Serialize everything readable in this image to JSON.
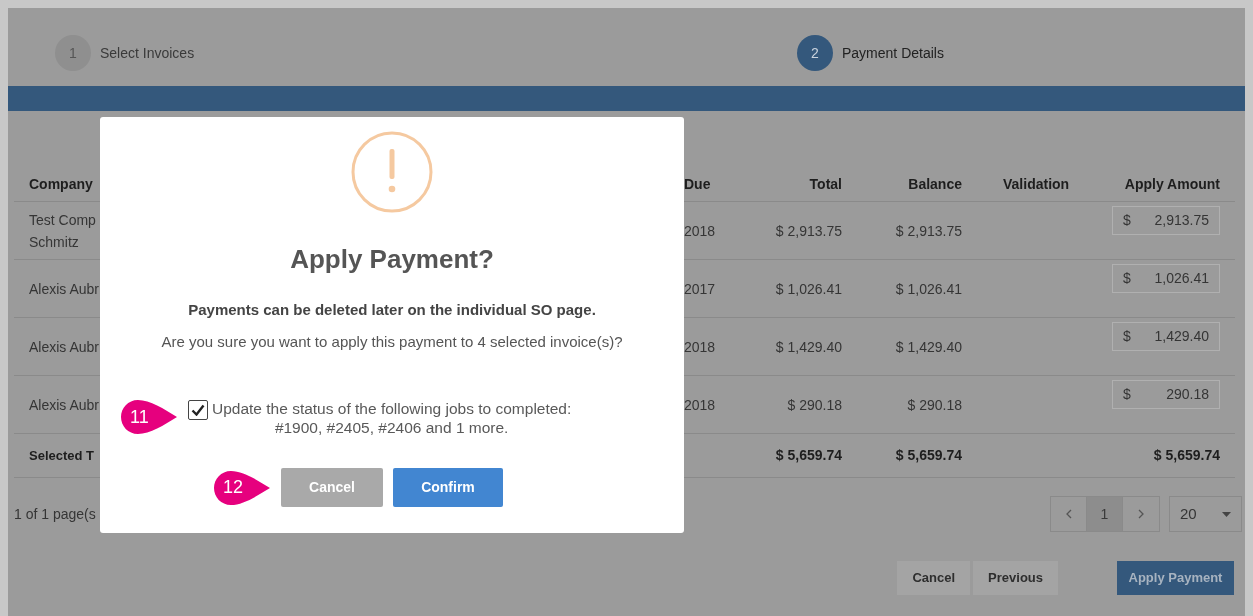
{
  "steps": [
    {
      "number": "1",
      "label": "Select Invoices",
      "selected": false
    },
    {
      "number": "2",
      "label": "Payment Details",
      "selected": true
    }
  ],
  "table": {
    "columns": [
      "Company",
      "Due",
      "Total",
      "Balance",
      "Validation",
      "Apply Amount"
    ],
    "rows": [
      {
        "company": [
          "Test Comp",
          "Schmitz"
        ],
        "due": "2018",
        "total": "$ 2,913.75",
        "balance": "$ 2,913.75",
        "currency": "$",
        "apply_amount": "2,913.75"
      },
      {
        "company": [
          "Alexis Aubr"
        ],
        "due": "2017",
        "total": "$ 1,026.41",
        "balance": "$ 1,026.41",
        "currency": "$",
        "apply_amount": "1,026.41"
      },
      {
        "company": [
          "Alexis Aubr"
        ],
        "due": "2018",
        "total": "$ 1,429.40",
        "balance": "$ 1,429.40",
        "currency": "$",
        "apply_amount": "1,429.40"
      },
      {
        "company": [
          "Alexis Aubr"
        ],
        "due": "2018",
        "total": "$ 290.18",
        "balance": "$ 290.18",
        "currency": "$",
        "apply_amount": "290.18"
      }
    ],
    "totals": {
      "label": "Selected T",
      "total": "$ 5,659.74",
      "balance": "$ 5,659.74",
      "apply_amount": "$ 5,659.74"
    }
  },
  "pagination": {
    "summary": "1 of 1 page(s",
    "pages": [
      {
        "label": "1",
        "selected": true
      }
    ],
    "page_size": "20"
  },
  "actions": [
    {
      "label": "Cancel",
      "kind": "secondary"
    },
    {
      "label": "Previous",
      "kind": "secondary"
    },
    {
      "label": "Apply Payment",
      "kind": "primary"
    }
  ],
  "dialog": {
    "title": "Apply Payment?",
    "note": "Payments can be deleted later on the individual SO page.",
    "question": "Are you sure you want to apply this payment to 4 selected invoice(s)?",
    "checkbox": {
      "checked": true,
      "lines": [
        "Update the status of the following jobs to completed:",
        "#1900, #2405, #2406 and 1 more."
      ]
    },
    "buttons": [
      {
        "label": "Cancel",
        "kind": "secondary"
      },
      {
        "label": "Confirm",
        "kind": "primary"
      }
    ],
    "callouts": [
      {
        "number": "11"
      },
      {
        "number": "12"
      }
    ]
  }
}
